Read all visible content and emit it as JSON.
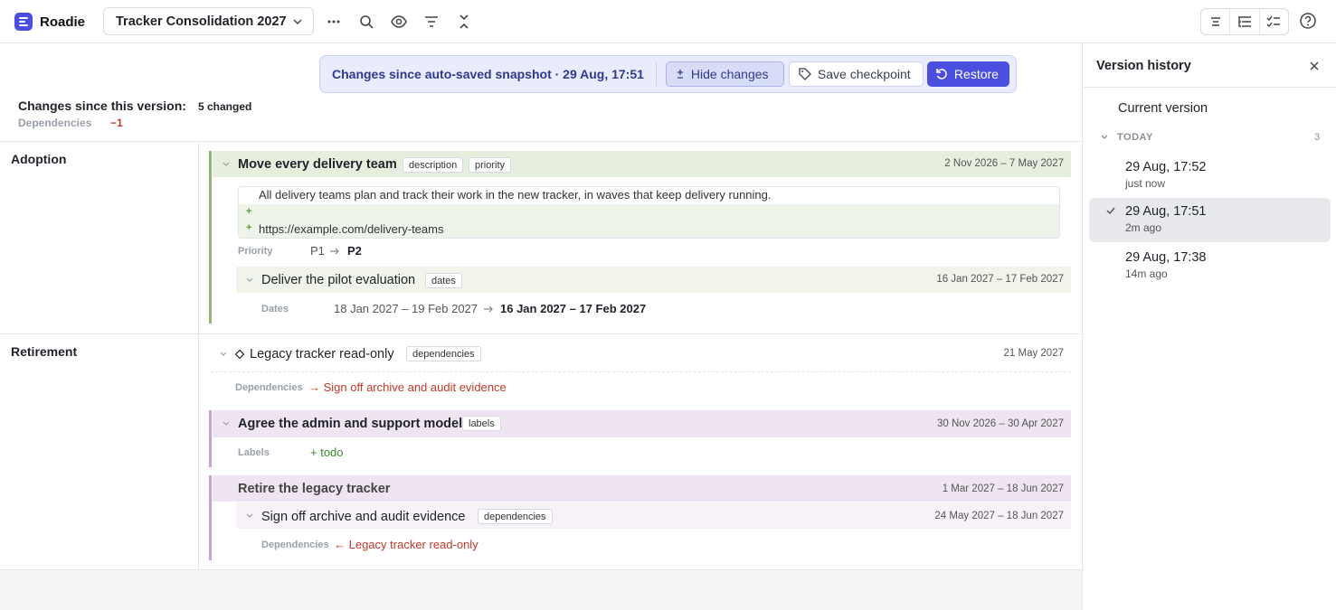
{
  "app": {
    "name": "Roadie",
    "brand_color": "#4b4fe0"
  },
  "header": {
    "plan_name": "Tracker Consolidation 2027",
    "icons": [
      "more-icon",
      "search-icon",
      "eye-icon",
      "filter-icon",
      "collapse-icon"
    ],
    "view_icons": [
      "outline-view-icon",
      "tree-view-icon",
      "checklist-view-icon"
    ],
    "help_icon": "help-icon"
  },
  "banner": {
    "text": "Changes since auto-saved snapshot · 29 Aug, 17:51",
    "hide_changes": "Hide changes",
    "save_checkpoint": "Save checkpoint",
    "restore": "Restore"
  },
  "summary": {
    "title": "Changes since this version:",
    "count": "5 changed",
    "dependencies_label": "Dependencies",
    "dependencies_delta": "−1"
  },
  "lanes": {
    "adoption": {
      "label": "Adoption",
      "item1": {
        "title": "Move every delivery team",
        "tags": [
          "description",
          "priority"
        ],
        "dates": "2 Nov 2026 – 7 May 2027",
        "description_lines": [
          {
            "text": "All delivery teams plan and track their work in the new tracker, in waves that keep delivery running.",
            "marker": ""
          },
          {
            "text": "",
            "marker": "+"
          },
          {
            "text": "https://example.com/delivery-teams",
            "marker": "+"
          }
        ],
        "priority_label": "Priority",
        "priority_old": "P1",
        "priority_new": "P2"
      },
      "item2": {
        "title": "Deliver the pilot evaluation",
        "tag": "dates",
        "dates": "16 Jan 2027 – 17 Feb 2027",
        "dates_label": "Dates",
        "dates_old": "18 Jan 2027 – 19 Feb 2027",
        "dates_new": "16 Jan 2027 – 17 Feb 2027"
      }
    },
    "retirement": {
      "label": "Retirement",
      "item1": {
        "title": "Legacy tracker read-only",
        "tag": "dependencies",
        "dates": "21 May 2027",
        "dep_label": "Dependencies",
        "dep_value": "→ Sign off archive and audit evidence"
      },
      "item2": {
        "title": "Agree the admin and support model",
        "tag": "labels",
        "dates": "30 Nov 2026 – 30 Apr 2027",
        "labels_label": "Labels",
        "labels_value": "+ todo"
      },
      "item3": {
        "title": "Retire the legacy tracker",
        "dates": "1 Mar 2027 – 18 Jun 2027"
      },
      "item4": {
        "title": "Sign off archive and audit evidence",
        "tag": "dependencies",
        "dates": "24 May 2027 – 18 Jun 2027",
        "dep_label": "Dependencies",
        "dep_value": "← Legacy tracker read-only"
      }
    }
  },
  "sidebar": {
    "title": "Version history",
    "current": "Current version",
    "group": {
      "label": "TODAY",
      "count": "3"
    },
    "versions": [
      {
        "time": "29 Aug, 17:52",
        "ago": "just now",
        "selected": false
      },
      {
        "time": "29 Aug, 17:51",
        "ago": "2m ago",
        "selected": true
      },
      {
        "time": "29 Aug, 17:38",
        "ago": "14m ago",
        "selected": false
      }
    ]
  }
}
